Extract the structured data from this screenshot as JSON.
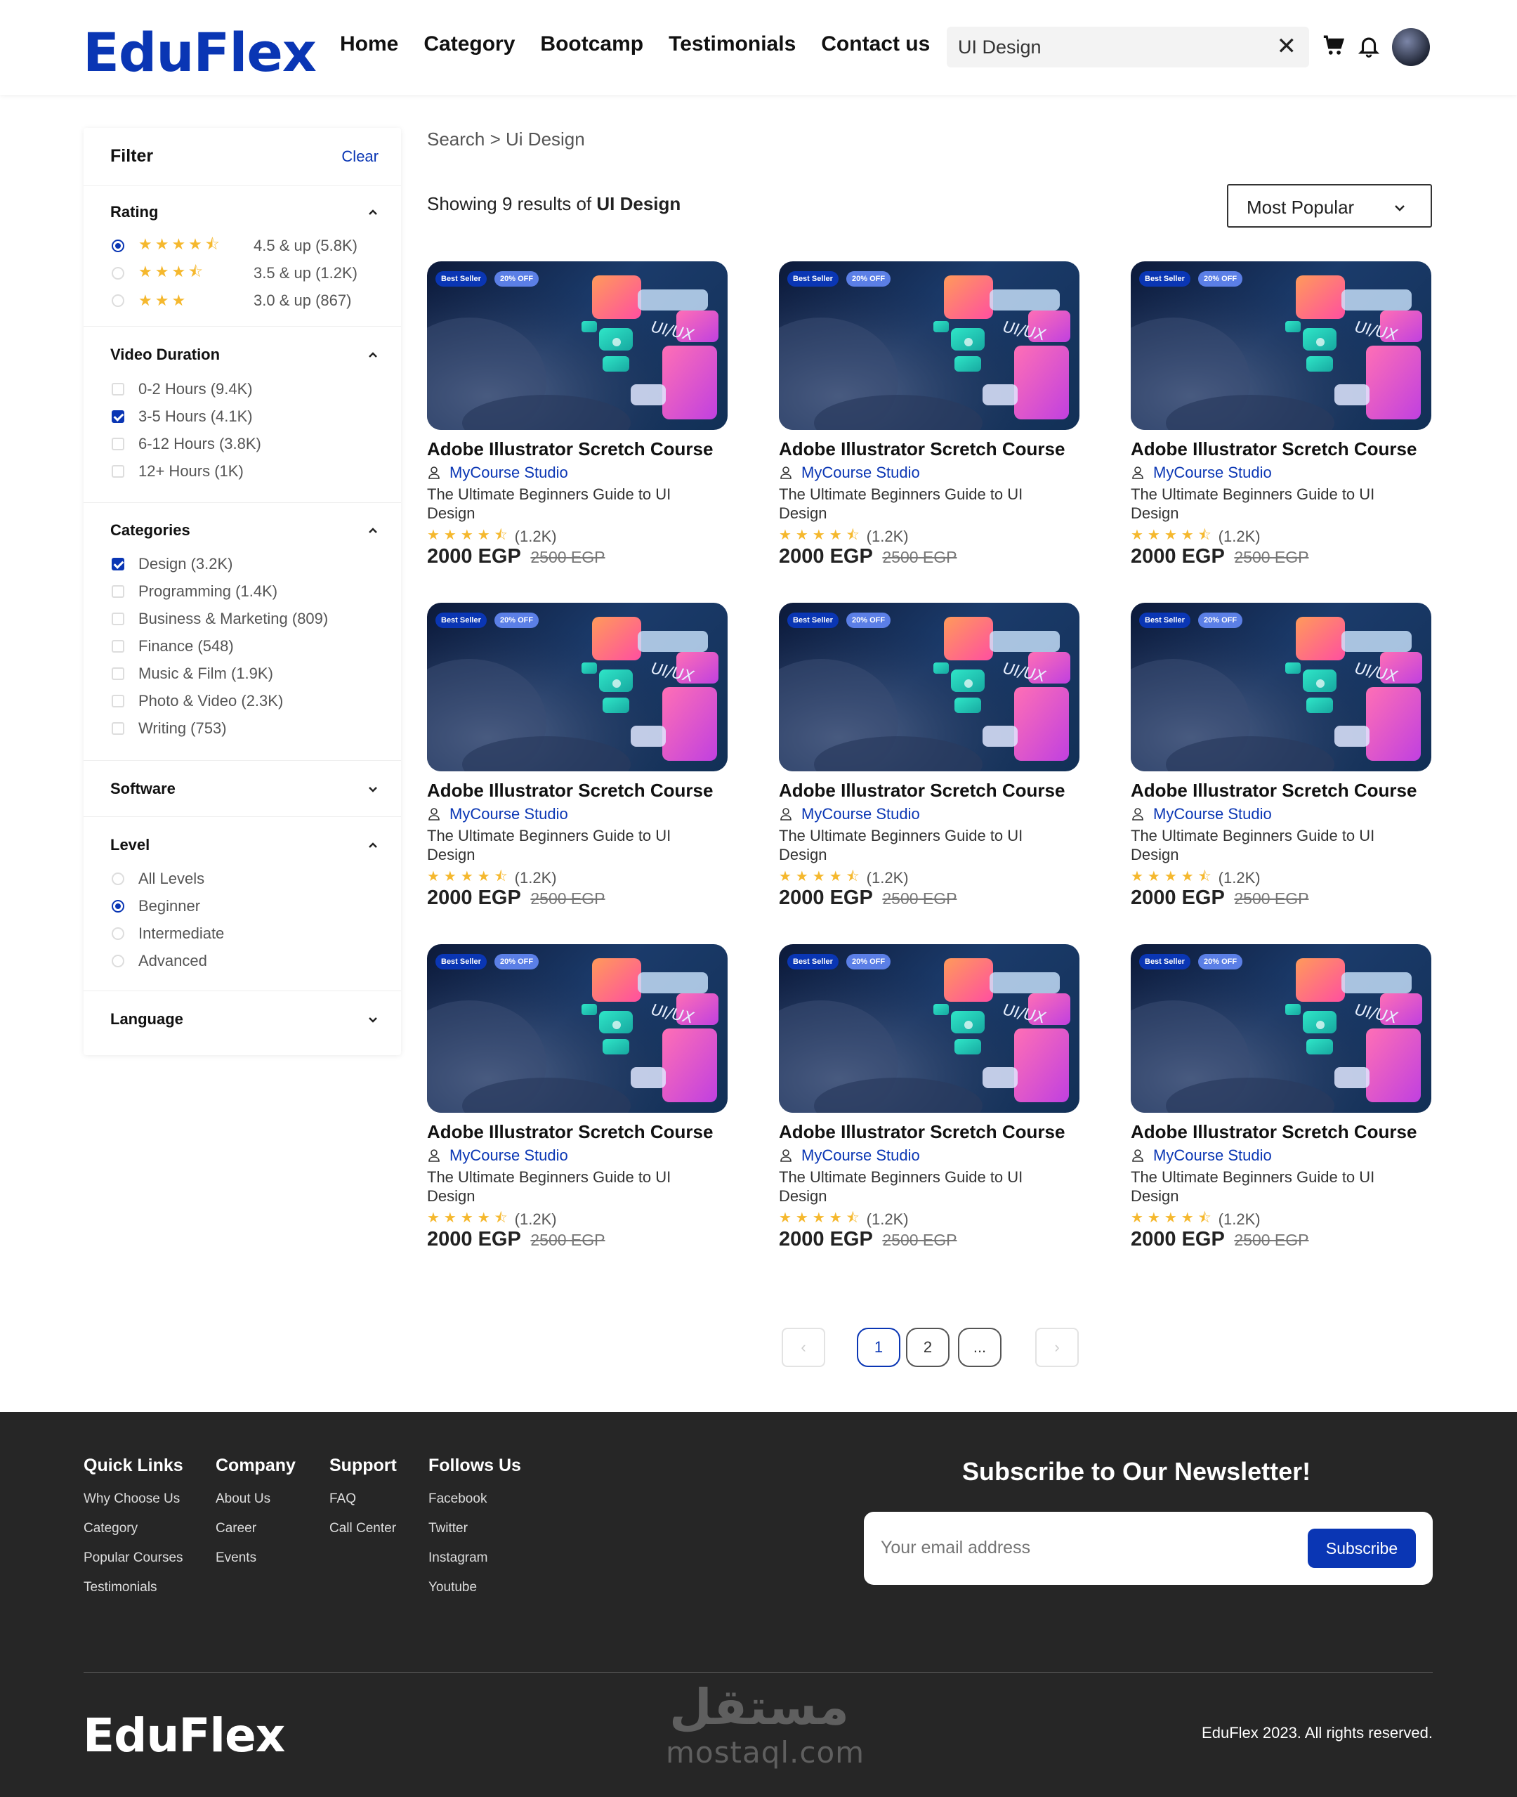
{
  "brand": {
    "logo": "EduFlex",
    "accent": "#0a36b4",
    "star_color": "#f5b82e"
  },
  "header": {
    "nav": [
      "Home",
      "Category",
      "Bootcamp",
      "Testimonials",
      "Contact us"
    ],
    "search_value": "UI Design",
    "icons": [
      "close-icon",
      "cart-icon",
      "bell-icon",
      "avatar"
    ]
  },
  "filter": {
    "title": "Filter",
    "clear": "Clear",
    "rating": {
      "title": "Rating",
      "options": [
        {
          "label": "4.5 & up (5.8K)",
          "stars": 4.5,
          "selected": true
        },
        {
          "label": "3.5 & up (1.2K)",
          "stars": 3.5,
          "selected": false
        },
        {
          "label": "3.0 & up (867)",
          "stars": 3,
          "selected": false
        }
      ]
    },
    "duration": {
      "title": "Video Duration",
      "options": [
        {
          "label": "0-2 Hours (9.4K)",
          "checked": false
        },
        {
          "label": "3-5 Hours (4.1K)",
          "checked": true
        },
        {
          "label": "6-12 Hours (3.8K)",
          "checked": false
        },
        {
          "label": "12+ Hours (1K)",
          "checked": false
        }
      ]
    },
    "categories": {
      "title": "Categories",
      "options": [
        {
          "label": "Design (3.2K)",
          "checked": true
        },
        {
          "label": "Programming (1.4K)",
          "checked": false
        },
        {
          "label": "Business & Marketing (809)",
          "checked": false
        },
        {
          "label": "Finance (548)",
          "checked": false
        },
        {
          "label": "Music & Film (1.9K)",
          "checked": false
        },
        {
          "label": "Photo & Video (2.3K)",
          "checked": false
        },
        {
          "label": "Writing (753)",
          "checked": false
        }
      ]
    },
    "software": {
      "title": "Software"
    },
    "level": {
      "title": "Level",
      "options": [
        {
          "label": "All Levels",
          "selected": false
        },
        {
          "label": "Beginner",
          "selected": true
        },
        {
          "label": "Intermediate",
          "selected": false
        },
        {
          "label": "Advanced",
          "selected": false
        }
      ]
    },
    "language": {
      "title": "Language"
    }
  },
  "main": {
    "breadcrumb": "Search > Ui Design",
    "results_prefix": "Showing 9 results of",
    "results_query": "UI Design",
    "sort": "Most Popular"
  },
  "course": {
    "badge_best": "Best Seller",
    "badge_off": "20% OFF",
    "thumb_label": "UI/UX",
    "title": "Adobe Illustrator Scretch Course",
    "author": "MyCourse Studio",
    "desc": "The Ultimate Beginners Guide to UI Design",
    "rating_count": "(1.2K)",
    "rating": 4.5,
    "price": "2000 EGP",
    "old_price": "2500 EGP"
  },
  "pagination": {
    "pages": [
      "1",
      "2",
      "..."
    ],
    "current": "1"
  },
  "footer": {
    "cols": [
      {
        "title": "Quick Links",
        "links": [
          "Why Choose Us",
          "Category",
          "Popular Courses",
          "Testimonials"
        ]
      },
      {
        "title": "Company",
        "links": [
          "About Us",
          "Career",
          "Events"
        ]
      },
      {
        "title": "Support",
        "links": [
          "FAQ",
          "Call Center"
        ]
      },
      {
        "title": "Follows Us",
        "links": [
          "Facebook",
          "Twitter",
          "Instagram",
          "Youtube"
        ]
      }
    ],
    "newsletter_title": "Subscribe to Our Newsletter!",
    "email_placeholder": "Your email address",
    "subscribe": "Subscribe",
    "logo": "EduFlex",
    "copyright": "EduFlex 2023. All rights reserved.",
    "watermark_ar": "مستقل",
    "watermark_lat": "mostaql.com"
  }
}
